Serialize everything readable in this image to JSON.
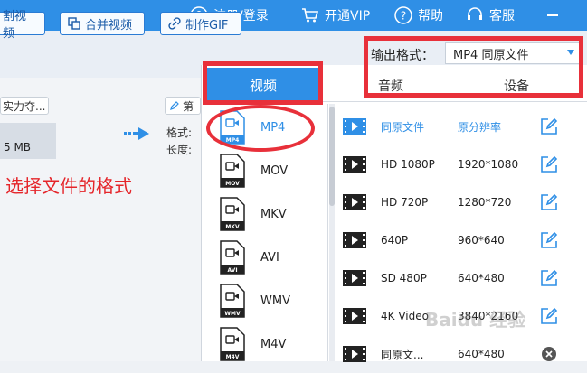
{
  "topbar": {
    "register_label": "注册/登录",
    "vip_label": "开通VIP",
    "help_label": "帮助",
    "service_label": "客服"
  },
  "toolbar": {
    "cut_label": "割视频",
    "merge_label": "合并视频",
    "gif_label": "制作GIF"
  },
  "output": {
    "label": "输出格式：",
    "value": "MP4  同原文件"
  },
  "file": {
    "name": "实力夺...",
    "size": "5 MB",
    "edit_label": "第",
    "format_label": "格式:",
    "length_label": "长度:"
  },
  "annotation": "选择文件的格式",
  "tabs": {
    "video": "视频",
    "audio": "音频",
    "device": "设备"
  },
  "formats": [
    "MP4",
    "MOV",
    "MKV",
    "AVI",
    "WMV",
    "M4V"
  ],
  "presets": [
    {
      "name": "同原文件",
      "res": "原分辨率"
    },
    {
      "name": "HD 1080P",
      "res": "1920*1080"
    },
    {
      "name": "HD 720P",
      "res": "1280*720"
    },
    {
      "name": "640P",
      "res": "960*640"
    },
    {
      "name": "SD 480P",
      "res": "640*480"
    },
    {
      "name": "4K Video",
      "res": "3840*2160"
    },
    {
      "name": "同原文...",
      "res": "640*480"
    }
  ],
  "watermark": "Baidu 经验",
  "colors": {
    "accent": "#2f8fe6",
    "highlight": "#e8303a"
  }
}
